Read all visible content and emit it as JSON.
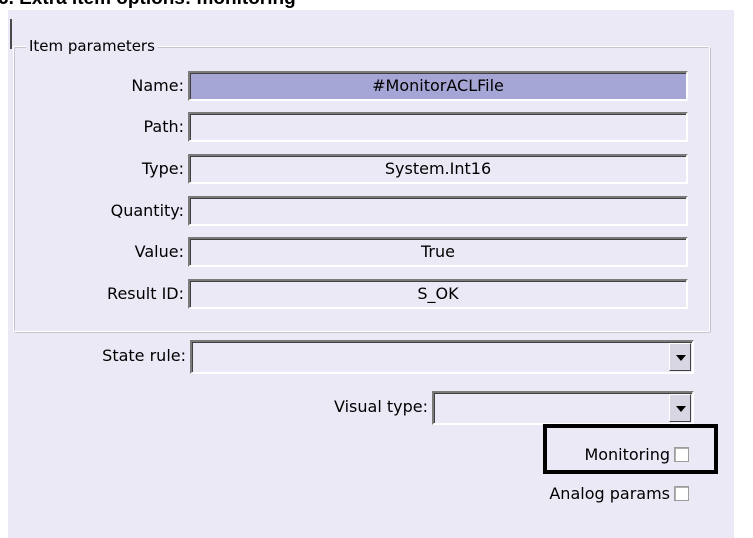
{
  "header": {
    "caption": "6. Extra item options: monitoring"
  },
  "groupbox": {
    "legend": "Item parameters"
  },
  "fields": [
    {
      "label": "Name:",
      "value": "#MonitorACLFile",
      "selected": true
    },
    {
      "label": "Path:",
      "value": ""
    },
    {
      "label": "Type:",
      "value": "System.Int16"
    },
    {
      "label": "Quantity:",
      "value": ""
    },
    {
      "label": "Value:",
      "value": "True"
    },
    {
      "label": "Result ID:",
      "value": "S_OK"
    }
  ],
  "state_rule": {
    "label": "State rule:",
    "value": ""
  },
  "visual_type": {
    "label": "Visual type:",
    "value": ""
  },
  "checkboxes": {
    "monitoring": {
      "label": "Monitoring",
      "checked": false
    },
    "analog_params": {
      "label": "Analog params",
      "checked": false
    }
  },
  "colors": {
    "panel": "#ECE9F6",
    "selected_field": "#A6A6D6",
    "highlight_border": "#000000"
  }
}
